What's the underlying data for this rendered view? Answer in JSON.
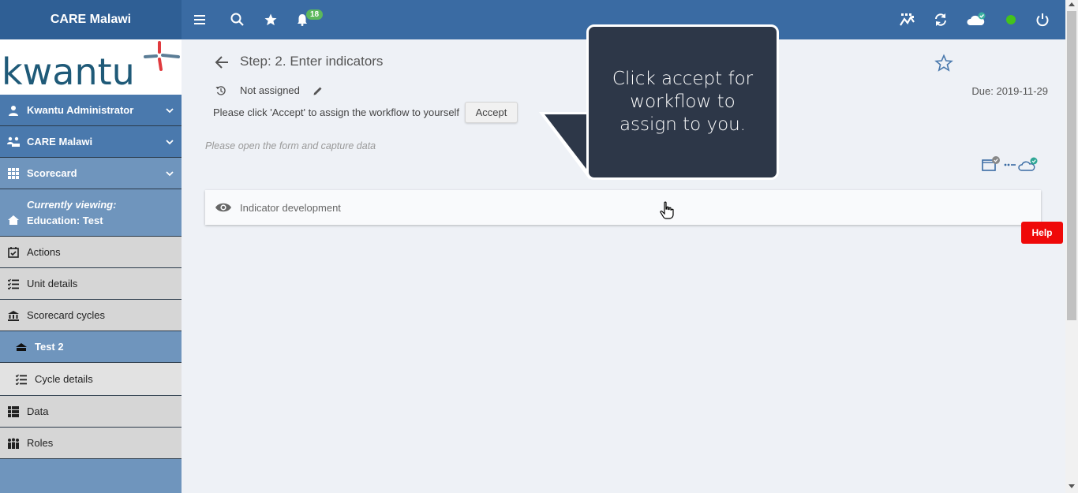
{
  "topbar": {
    "brand": "CARE Malawi",
    "notification_count": "18"
  },
  "sidebar": {
    "logo_text": "kwantu",
    "items": [
      {
        "label": "Kwantu Administrator"
      },
      {
        "label": "CARE Malawi"
      },
      {
        "label": "Scorecard"
      },
      {
        "label": "Actions"
      },
      {
        "label": "Unit details"
      },
      {
        "label": "Scorecard cycles"
      },
      {
        "label": "Test 2"
      },
      {
        "label": "Cycle details"
      },
      {
        "label": "Data"
      },
      {
        "label": "Roles"
      }
    ],
    "viewing": {
      "heading": "Currently viewing:",
      "value": "Education: Test"
    }
  },
  "main": {
    "step_title": "Step: 2. Enter indicators",
    "due": "Due: 2019-11-29",
    "assignee": "Not assigned",
    "accept_message": "Please click 'Accept' to assign the workflow to yourself",
    "accept_label": "Accept",
    "hint": "Please open the form and capture data",
    "panel_label": "Indicator development",
    "help_label": "Help"
  },
  "tooltip": {
    "text": "Click accept for workflow to assign to you."
  },
  "colors": {
    "topbar": "#3a6ba3",
    "brand_bg": "#2f5f95",
    "sidebar_dark": "#4a79ad",
    "sidebar_mid": "#6f95bd",
    "help": "#ef0909",
    "tooltip_bg": "#2d3748",
    "badge": "#5cb85c",
    "status_online": "#44c31b"
  }
}
